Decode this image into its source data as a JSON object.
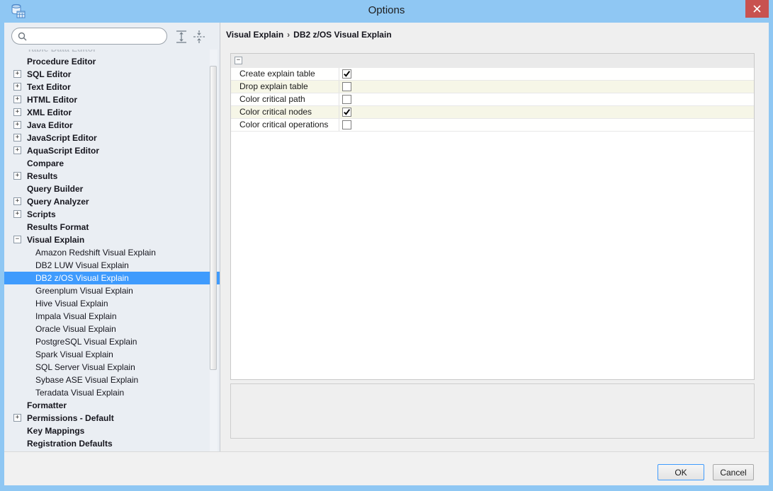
{
  "window": {
    "title": "Options"
  },
  "icons": {
    "plus": "+",
    "minus": "−"
  },
  "search": {
    "value": "",
    "placeholder": ""
  },
  "sidebar": {
    "items": [
      {
        "label": "Table Data Editor",
        "bold": true,
        "toggle": "none",
        "clipped": true
      },
      {
        "label": "Procedure Editor",
        "bold": true,
        "toggle": "none"
      },
      {
        "label": "SQL Editor",
        "bold": true,
        "toggle": "plus"
      },
      {
        "label": "Text Editor",
        "bold": true,
        "toggle": "plus"
      },
      {
        "label": "HTML Editor",
        "bold": true,
        "toggle": "plus"
      },
      {
        "label": "XML Editor",
        "bold": true,
        "toggle": "plus"
      },
      {
        "label": "Java Editor",
        "bold": true,
        "toggle": "plus"
      },
      {
        "label": "JavaScript Editor",
        "bold": true,
        "toggle": "plus"
      },
      {
        "label": "AquaScript Editor",
        "bold": true,
        "toggle": "plus"
      },
      {
        "label": "Compare",
        "bold": true,
        "toggle": "none"
      },
      {
        "label": "Results",
        "bold": true,
        "toggle": "plus"
      },
      {
        "label": "Query Builder",
        "bold": true,
        "toggle": "none"
      },
      {
        "label": "Query Analyzer",
        "bold": true,
        "toggle": "plus"
      },
      {
        "label": "Scripts",
        "bold": true,
        "toggle": "plus"
      },
      {
        "label": "Results Format",
        "bold": true,
        "toggle": "none"
      },
      {
        "label": "Visual Explain",
        "bold": true,
        "toggle": "minus"
      },
      {
        "label": "Amazon Redshift Visual Explain",
        "child": true
      },
      {
        "label": "DB2 LUW Visual Explain",
        "child": true
      },
      {
        "label": "DB2 z/OS Visual Explain",
        "child": true,
        "selected": true
      },
      {
        "label": "Greenplum Visual Explain",
        "child": true
      },
      {
        "label": "Hive Visual Explain",
        "child": true
      },
      {
        "label": "Impala Visual Explain",
        "child": true
      },
      {
        "label": "Oracle Visual Explain",
        "child": true
      },
      {
        "label": "PostgreSQL Visual Explain",
        "child": true
      },
      {
        "label": "Spark Visual Explain",
        "child": true
      },
      {
        "label": "SQL Server Visual Explain",
        "child": true
      },
      {
        "label": "Sybase ASE Visual Explain",
        "child": true
      },
      {
        "label": "Teradata Visual Explain",
        "child": true
      },
      {
        "label": "Formatter",
        "bold": true,
        "toggle": "none"
      },
      {
        "label": "Permissions - Default",
        "bold": true,
        "toggle": "plus"
      },
      {
        "label": "Key Mappings",
        "bold": true,
        "toggle": "none"
      },
      {
        "label": "Registration Defaults",
        "bold": true,
        "toggle": "none"
      }
    ]
  },
  "breadcrumb": {
    "parent": "Visual Explain",
    "separator": "›",
    "current": "DB2 z/OS Visual Explain"
  },
  "options_panel": {
    "group_toggle": "−",
    "rows": [
      {
        "label": "Create explain table",
        "checked": true
      },
      {
        "label": "Drop explain table",
        "checked": false
      },
      {
        "label": "Color critical path",
        "checked": false
      },
      {
        "label": "Color critical nodes",
        "checked": true
      },
      {
        "label": "Color critical operations",
        "checked": false
      }
    ]
  },
  "footer": {
    "ok_label": "OK",
    "cancel_label": "Cancel"
  },
  "colors": {
    "window-border": "#8fc7f3",
    "titlebar": "#8fc7f3",
    "close-btn": "#c85250",
    "selection": "#3f9bfd",
    "row-alt": "#f6f6e7",
    "sidebar-bg": "#eaeef3",
    "content-bg": "#efefef"
  }
}
